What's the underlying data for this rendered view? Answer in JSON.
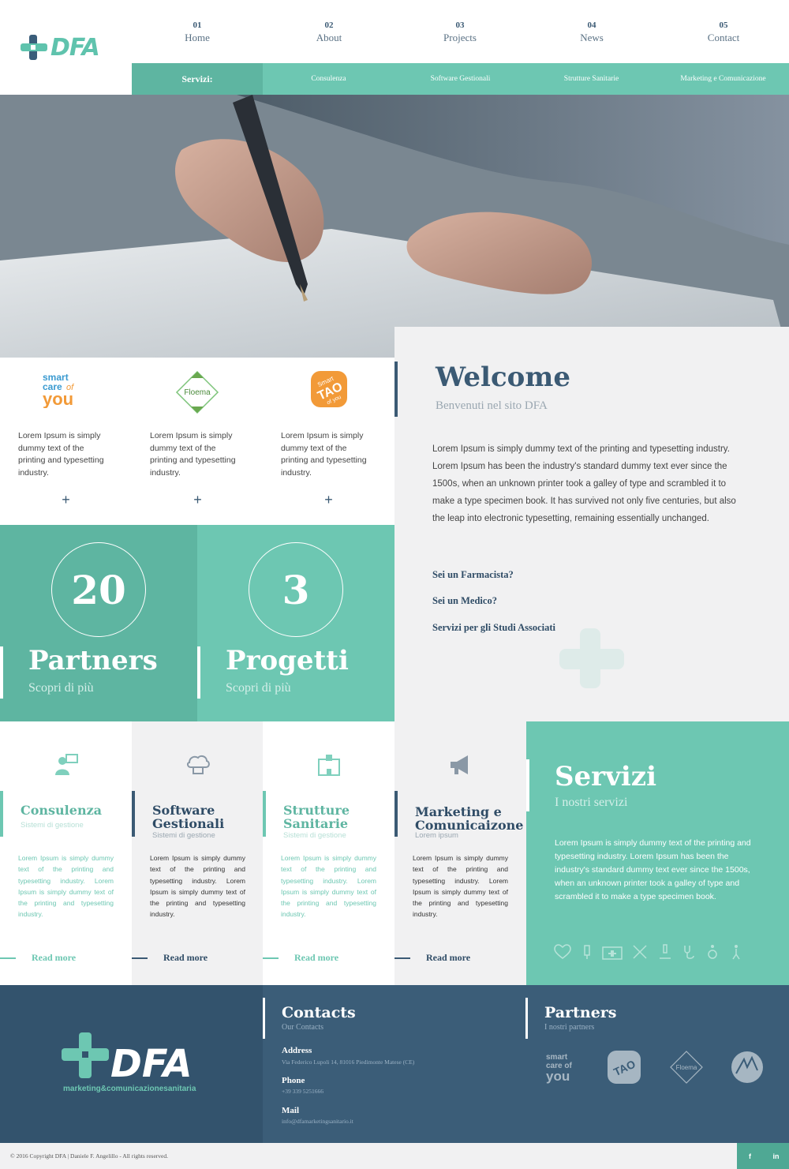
{
  "brand": {
    "name": "DFA",
    "tagline": "marketing&comunicazionesanitaria"
  },
  "nav": [
    {
      "num": "01",
      "label": "Home"
    },
    {
      "num": "02",
      "label": "About"
    },
    {
      "num": "03",
      "label": "Projects"
    },
    {
      "num": "04",
      "label": "News"
    },
    {
      "num": "05",
      "label": "Contact"
    }
  ],
  "services_bar": {
    "label": "Servizi:",
    "items": [
      "Consulenza",
      "Software Gestionali",
      "Strutture Sanitarie",
      "Marketing e Comunicazione"
    ]
  },
  "partner_cards": [
    {
      "logo": "smart care of you",
      "desc": "Lorem Ipsum is simply dummy text of the printing and typesetting industry."
    },
    {
      "logo": "Floema",
      "desc": "Lorem Ipsum is simply dummy text of the printing and typesetting industry."
    },
    {
      "logo": "Smart TAO of you",
      "desc": "Lorem Ipsum is simply dummy text of the printing and typesetting industry."
    }
  ],
  "plus": "+",
  "welcome": {
    "title": "Welcome",
    "subtitle": "Benvenuti nel sito DFA",
    "body": "Lorem Ipsum is simply dummy text of the printing and typesetting industry. Lorem Ipsum has been the industry's standard dummy text ever since the 1500s, when an unknown printer took a galley of type and scrambled it to make a type specimen book. It has survived not only five centuries, but also the leap into electronic typesetting, remaining essentially unchanged.",
    "links": [
      "Sei un Farmacista?",
      "Sei un Medico?",
      "Servizi per gli Studi Associati"
    ]
  },
  "stats": [
    {
      "value": "20",
      "title": "Partners",
      "more": "Scopri di più",
      "color": "#5eb5a1"
    },
    {
      "value": "3",
      "title": "Progetti",
      "more": "Scopri di più",
      "color": "#6dc7b2"
    }
  ],
  "service_cards": [
    {
      "title": "Consulenza",
      "subtitle": "Sistemi di gestione",
      "desc": "Lorem Ipsum is simply dummy text of the printing and typesetting industry. Lorem Ipsum is simply dummy text of the printing and typesetting industry.",
      "read_more": "Read more",
      "icon": "consultant-icon"
    },
    {
      "title": "Software Gestionali",
      "subtitle": "Sistemi di gestione",
      "desc": "Lorem Ipsum is simply dummy text of the printing and typesetting industry. Lorem Ipsum is simply dummy text of the printing and typesetting industry.",
      "read_more": "Read more",
      "icon": "software-icon"
    },
    {
      "title": "Strutture Sanitarie",
      "subtitle": "Sistemi di gestione",
      "desc": "Lorem Ipsum is simply dummy text of the printing and typesetting industry. Lorem Ipsum is simply dummy text of the printing and typesetting industry.",
      "read_more": "Read more",
      "icon": "hospital-icon"
    },
    {
      "title": "Marketing e Comunicaizone",
      "subtitle": "Lorem ipsum",
      "desc": "Lorem Ipsum is simply dummy text of the printing and typesetting industry. Lorem Ipsum is simply dummy text of the printing and typesetting industry.",
      "read_more": "Read more",
      "icon": "megaphone-icon"
    }
  ],
  "servizi": {
    "title": "Servizi",
    "subtitle": "I nostri servizi",
    "desc": "Lorem Ipsum is simply dummy text of the printing and typesetting industry. Lorem Ipsum has been the industry's standard dummy text ever since the 1500s, when an unknown printer took a galley of type and scrambled it to make a type specimen book."
  },
  "footer": {
    "contacts_title": "Contacts",
    "contacts_sub": "Our Contacts",
    "address_label": "Address",
    "address": "Via Federico Lupoli 14, 81016 Piedimonte Matese (CE)",
    "phone_label": "Phone",
    "phone": "+39 339 5251666",
    "mail_label": "Mail",
    "mail": "info@dfamarketingsanitario.it",
    "partners_title": "Partners",
    "partners_sub": "I nostri partners"
  },
  "copyright": "© 2016 Copyright DFA | Daniele F. Angelillo - All rights reserved.",
  "social": [
    "f",
    "in"
  ],
  "colors": {
    "teal": "#6dc7b2",
    "teal_dark": "#5eb5a1",
    "navy": "#3b5a74",
    "footer": "#3b5d78"
  }
}
